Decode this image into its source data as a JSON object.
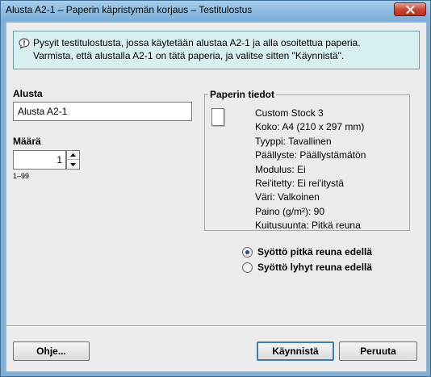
{
  "window": {
    "title": "Alusta A2-1 – Paperin käpristymän korjaus – Testitulostus"
  },
  "info": {
    "line1": "Pysyit testitulostusta, jossa käytetään alustaa A2-1 ja alla osoitettua paperia.",
    "line2": "Varmista, että alustalla A2-1 on tätä paperia, ja valitse sitten \"Käynnistä\"."
  },
  "tray": {
    "label": "Alusta",
    "value": "Alusta A2-1"
  },
  "quantity": {
    "label": "Määrä",
    "value": "1",
    "range": "1–99"
  },
  "paper": {
    "legend": "Paperin tiedot",
    "lines": [
      "Custom Stock 3",
      "Koko: A4 (210 x 297 mm)",
      "Tyyppi: Tavallinen",
      "Päällyste: Päällystämätön",
      "Modulus: Ei",
      "Rei'itetty: Ei rei'itystä",
      "Väri: Valkoinen",
      "Paino (g/m²): 90",
      "Kuitusuunta: Pitkä reuna"
    ]
  },
  "feed": {
    "options": [
      {
        "label": "Syöttö pitkä reuna edellä",
        "selected": true
      },
      {
        "label": "Syöttö lyhyt reuna edellä",
        "selected": false
      }
    ]
  },
  "buttons": {
    "help": "Ohje...",
    "start": "Käynnistä",
    "cancel": "Peruuta"
  }
}
